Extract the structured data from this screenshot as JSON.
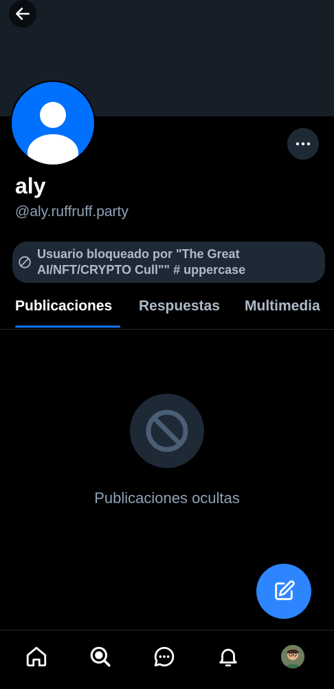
{
  "profile": {
    "display_name": "aly",
    "handle": "@aly.ruffruff.party",
    "blocked_notice": "Usuario bloqueado por \"The Great AI/NFT/CRYPTO Cull\"\" # uppercase"
  },
  "tabs": [
    {
      "label": "Publicaciones",
      "active": true
    },
    {
      "label": "Respuestas",
      "active": false
    },
    {
      "label": "Multimedia",
      "active": false
    }
  ],
  "empty_state": {
    "text": "Publicaciones ocultas",
    "icon": "ban-icon"
  },
  "bottom_nav": [
    {
      "name": "home",
      "icon": "home-icon"
    },
    {
      "name": "search",
      "icon": "search-icon"
    },
    {
      "name": "chat",
      "icon": "chat-icon"
    },
    {
      "name": "notifications",
      "icon": "bell-icon"
    },
    {
      "name": "my-profile",
      "icon": "avatar"
    }
  ],
  "colors": {
    "accent": "#0f73ff",
    "fab": "#2d86ff",
    "avatar_bg": "#0070ff",
    "banner": "#161e27",
    "surface": "#1e2936"
  }
}
